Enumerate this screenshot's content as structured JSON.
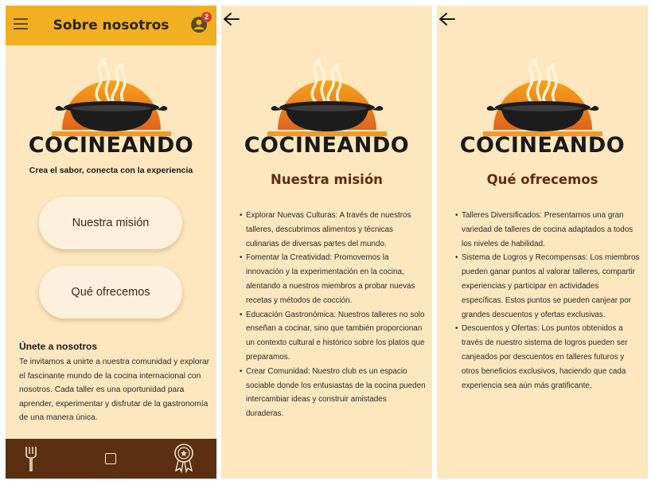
{
  "colors": {
    "background": "#fde7bf",
    "appbar": "#f0b022",
    "bottom_nav": "#5a2f12",
    "title_brown": "#5a2f12",
    "badge": "#d43c2a"
  },
  "screen1": {
    "header": {
      "title": "Sobre nosotros",
      "menu_icon": "hamburger-menu-icon",
      "notification_icon": "user-notification-icon",
      "notification_count": "2"
    },
    "brand": "COCINEANDO",
    "tagline": "Crea el sabor, conecta con la experiencia",
    "buttons": {
      "mision": "Nuestra misión",
      "ofrecemos": "Qué ofrecemos"
    },
    "join": {
      "title": "Únete a nosotros",
      "text": "Te invitamos a unirte a nuestra comunidad y explorar el fascinante mundo de la cocina internacional con nosotros. Cada taller es una oportunidad para aprender, experimentar y disfrutar de la gastronomía de una manera única."
    },
    "bottom_nav": [
      "fork-icon",
      "square-icon",
      "award-badge-icon"
    ]
  },
  "screen2": {
    "back_icon": "arrow-left-icon",
    "brand": "COCINEANDO",
    "title": "Nuestra misión",
    "items": [
      "Explorar Nuevas Culturas: A través de nuestros talleres, descubrimos alimentos y técnicas culinarias de diversas partes del mundo.",
      "Fomentar la Creatividad: Promovemos la innovación y la experimentación en la cocina, alentando a nuestros miembros a probar nuevas recetas y métodos de cocción.",
      "Educación Gastronómica: Nuestros talleres no solo enseñan a cocinar, sino que también proporcionan un contexto cultural e histórico sobre los platos que preparamos.",
      "Crear Comunidad: Nuestro club es un espacio sociable donde los entusiastas de la cocina pueden intercambiar ideas y construir amistades duraderas."
    ]
  },
  "screen3": {
    "back_icon": "arrow-left-icon",
    "brand": "COCINEANDO",
    "title": "Qué ofrecemos",
    "items": [
      "Talleres Diversificados: Presentamos una gran variedad de talleres de cocina adaptados a todos los niveles de habilidad.",
      "Sistema de Logros y Recompensas: Los miembros pueden ganar puntos al valorar talleres, compartir experiencias y participar en actividades específicas. Estos puntos se pueden canjear por grandes descuentos y ofertas exclusivas.",
      "Descuentos y Ofertas: Los puntos obtenidos a través de nuestro sistema de logros pueden ser canjeados por descuentos en talleres futuros y otros beneficios exclusivos, haciendo que cada experiencia sea aún más gratificante."
    ]
  }
}
